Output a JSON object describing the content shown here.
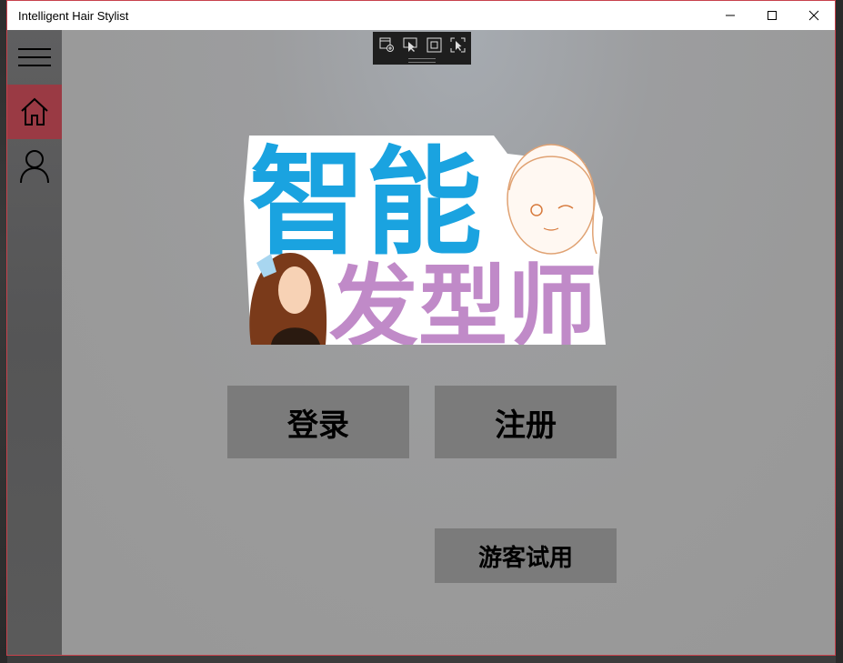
{
  "window": {
    "title": "Intelligent Hair Stylist",
    "controls": {
      "minimize": "minimize-icon",
      "maximize": "maximize-icon",
      "close": "close-icon"
    }
  },
  "sidebar": {
    "items": [
      {
        "icon": "hamburger-menu-icon"
      },
      {
        "icon": "home-icon",
        "selected": true
      },
      {
        "icon": "user-icon"
      }
    ]
  },
  "logo": {
    "line1": "智能",
    "line2": "发型师"
  },
  "buttons": {
    "login": "登录",
    "register": "注册",
    "guest": "游客试用"
  },
  "colors": {
    "accent": "#9a3a44",
    "window_border": "#c8424c",
    "logo_blue": "#1aa3e0",
    "logo_purple": "#c08ac8",
    "button_bg": "#7b7b7b"
  }
}
